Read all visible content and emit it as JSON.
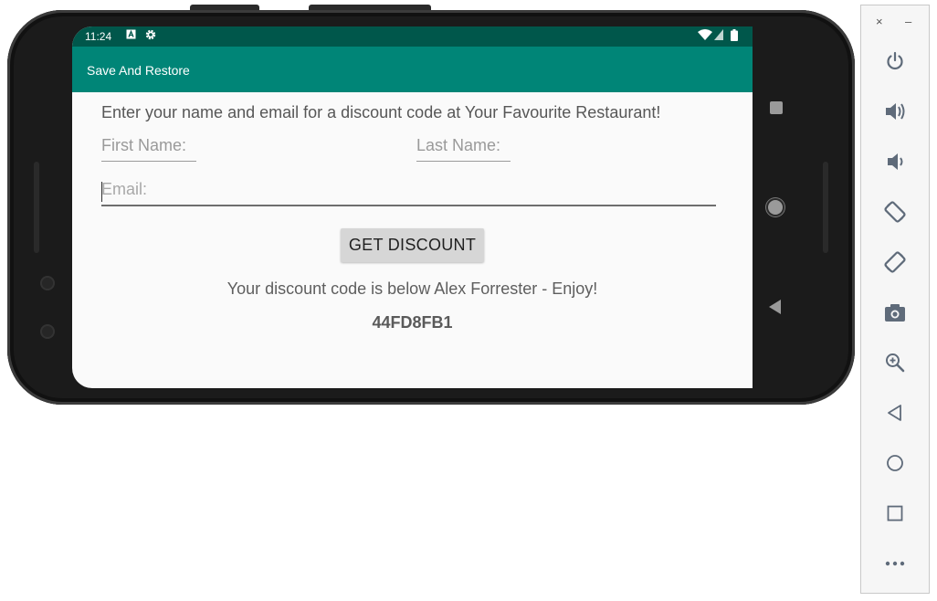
{
  "status_bar": {
    "time": "11:24",
    "icons": [
      "a-notification-icon",
      "settings-gear-icon",
      "wifi-icon",
      "signal-icon",
      "battery-icon"
    ]
  },
  "app_bar": {
    "title": "Save And Restore"
  },
  "form": {
    "prompt": "Enter your name and email for a discount code at Your Favourite Restaurant!",
    "first_name_placeholder": "First Name:",
    "last_name_placeholder": "Last Name:",
    "email_placeholder": "Email:",
    "button_label": "GET DISCOUNT",
    "result_message": "Your discount code is below Alex Forrester - Enjoy!",
    "discount_code": "44FD8FB1"
  },
  "emulator_toolbar": {
    "close": "×",
    "minimize": "–",
    "tools": [
      "power-icon",
      "volume-up-icon",
      "volume-down-icon",
      "rotate-left-icon",
      "rotate-right-icon",
      "camera-icon",
      "zoom-icon",
      "back-icon",
      "home-icon",
      "overview-icon",
      "more-icon"
    ]
  },
  "colors": {
    "status_bar": "#00574b",
    "app_bar": "#008577",
    "button": "#d6d6d6"
  }
}
